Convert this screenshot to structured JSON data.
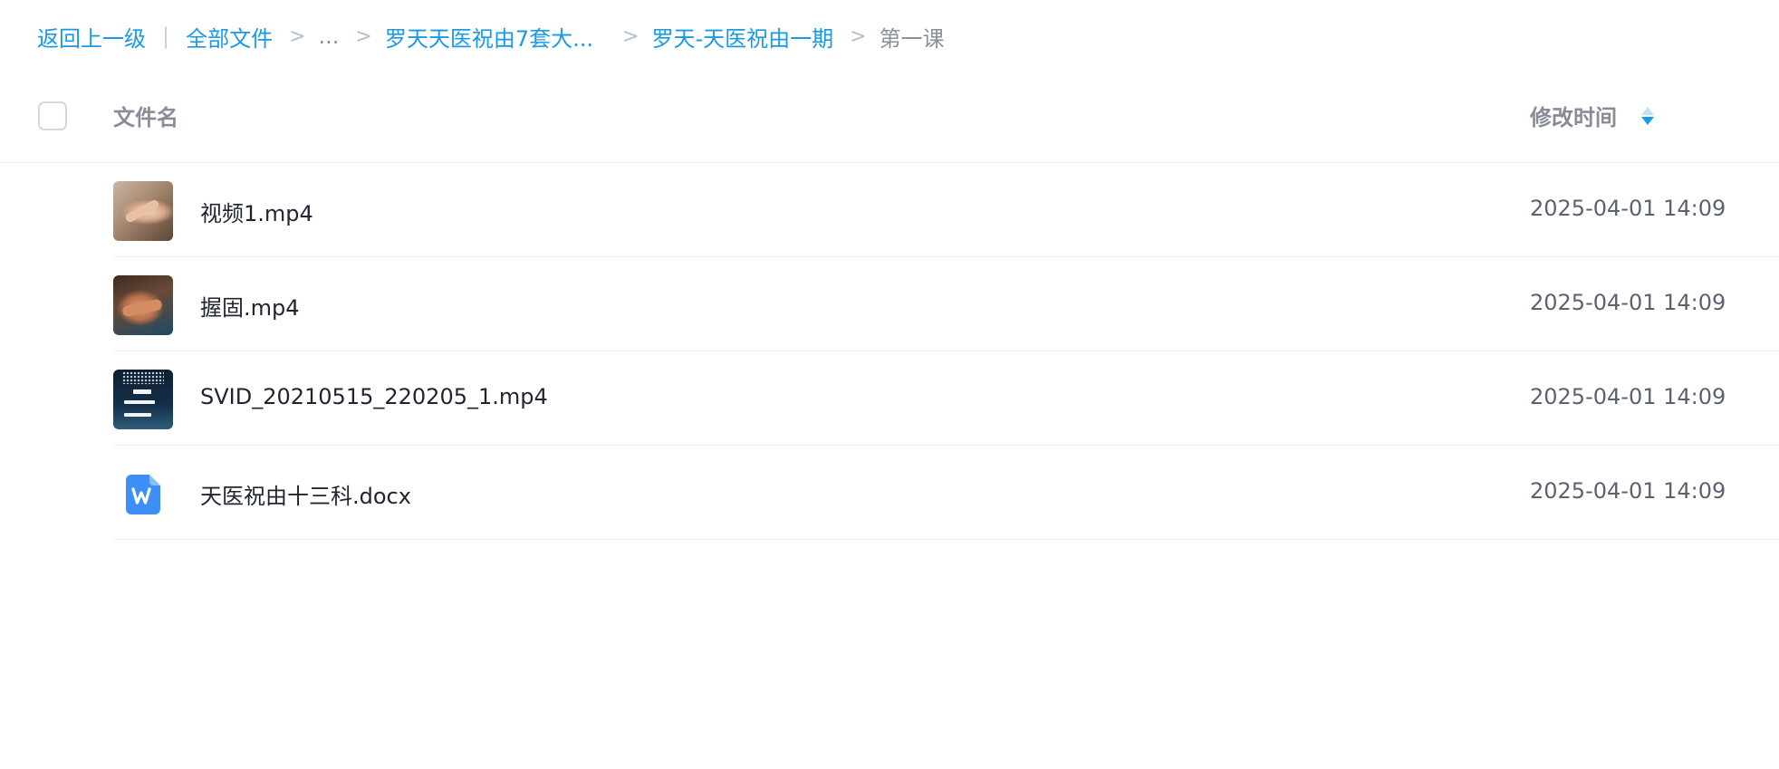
{
  "breadcrumb": {
    "back_label": "返回上一级",
    "divider": "|",
    "items": [
      {
        "label": "全部文件"
      },
      {
        "label": "..."
      },
      {
        "label": "罗天天医祝由7套大..."
      },
      {
        "label": "罗天-天医祝由一期"
      }
    ],
    "current": "第一课",
    "separator": ">"
  },
  "header": {
    "name_column": "文件名",
    "time_column": "修改时间",
    "sort_icon": "sort-desc-icon"
  },
  "files": [
    {
      "name": "视频1.mp4",
      "modified": "2025-04-01 14:09",
      "icon": "video-thumbnail"
    },
    {
      "name": "握固.mp4",
      "modified": "2025-04-01 14:09",
      "icon": "video-thumbnail"
    },
    {
      "name": "SVID_20210515_220205_1.mp4",
      "modified": "2025-04-01 14:09",
      "icon": "video-thumbnail"
    },
    {
      "name": "天医祝由十三科.docx",
      "modified": "2025-04-01 14:09",
      "icon": "word-doc-icon"
    }
  ],
  "colors": {
    "accent": "#1a9ae6",
    "word_icon": "#3d8ff5"
  }
}
